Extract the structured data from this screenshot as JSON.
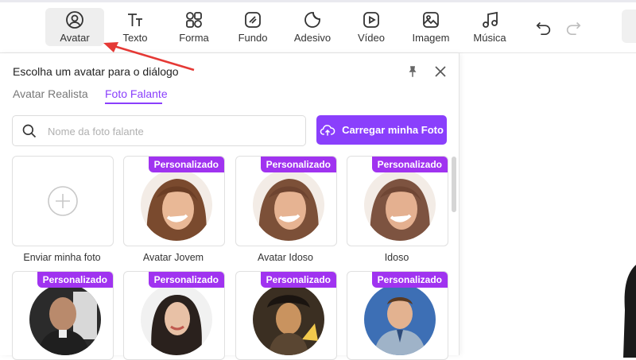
{
  "toolbar": {
    "items": [
      {
        "label": "Avatar",
        "icon": "user-circle-icon",
        "active": true
      },
      {
        "label": "Texto",
        "icon": "text-icon"
      },
      {
        "label": "Forma",
        "icon": "shapes-icon"
      },
      {
        "label": "Fundo",
        "icon": "background-icon"
      },
      {
        "label": "Adesivo",
        "icon": "sticker-icon"
      },
      {
        "label": "Vídeo",
        "icon": "video-icon"
      },
      {
        "label": "Imagem",
        "icon": "image-icon"
      },
      {
        "label": "Música",
        "icon": "music-icon"
      }
    ]
  },
  "panel": {
    "title": "Escolha um avatar para o diálogo",
    "tabs": [
      {
        "label": "Avatar Realista",
        "active": false
      },
      {
        "label": "Foto Falante",
        "active": true
      }
    ],
    "search_placeholder": "Nome da foto falante",
    "upload_label": "Carregar minha Foto",
    "cards": [
      {
        "label": "Enviar minha foto",
        "badge": ""
      },
      {
        "label": "Avatar Jovem",
        "badge": "Personalizado"
      },
      {
        "label": "Avatar Idoso",
        "badge": "Personalizado"
      },
      {
        "label": "Idoso",
        "badge": "Personalizado"
      },
      {
        "label": "",
        "badge": "Personalizado"
      },
      {
        "label": "",
        "badge": "Personalizado"
      },
      {
        "label": "",
        "badge": "Personalizado"
      },
      {
        "label": "",
        "badge": "Personalizado"
      }
    ]
  },
  "colors": {
    "accent": "#8a3ffc",
    "badge": "#a033f0",
    "arrow": "#e53935"
  }
}
